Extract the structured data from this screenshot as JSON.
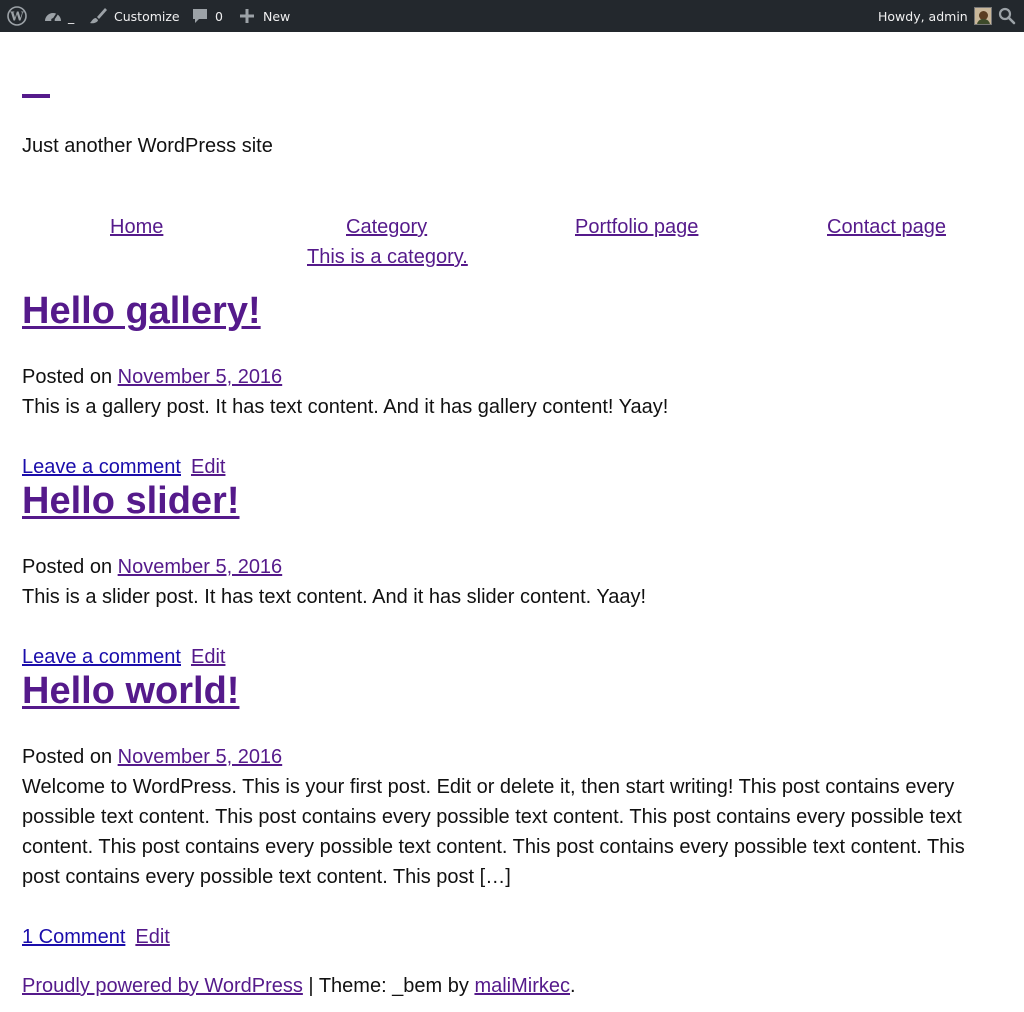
{
  "admin_bar": {
    "wp_logo_icon": "wordpress-logo-icon",
    "dashboard_icon": "dashboard-gauge-icon",
    "site_name": "_",
    "customize_label": "Customize",
    "comments_count": "0",
    "new_label": "New",
    "howdy_label": "Howdy, admin",
    "search_icon": "search-icon",
    "colors": {
      "background": "#23282d",
      "text": "#eeeeee",
      "muted": "#9ca2a7"
    }
  },
  "site": {
    "tagline": "Just another WordPress site",
    "accent": "#551a8b"
  },
  "nav": {
    "items": [
      {
        "label": "Home"
      },
      {
        "label": "Category"
      },
      {
        "label": "Portfolio page"
      },
      {
        "label": "Contact page"
      },
      {
        "label": "This is a category."
      }
    ]
  },
  "posts": [
    {
      "title": "Hello gallery!",
      "posted_on_label": "Posted on",
      "date": "November 5, 2016",
      "excerpt": "This is a gallery post. It has text content. And it has gallery content! Yaay!",
      "comment_link": "Leave a comment",
      "edit_link": "Edit"
    },
    {
      "title": "Hello slider!",
      "posted_on_label": "Posted on",
      "date": "November 5, 2016",
      "excerpt": "This is a slider post. It has text content. And it has slider content. Yaay!",
      "comment_link": "Leave a comment",
      "edit_link": "Edit"
    },
    {
      "title": "Hello world!",
      "posted_on_label": "Posted on",
      "date": "November 5, 2016",
      "excerpt": "Welcome to WordPress. This is your first post. Edit or delete it, then start writing! This post contains every possible text content. This post contains every possible text content. This post contains every possible text content. This post contains every possible text content. This post contains every possible text content. This post contains every possible text content. This post […]",
      "comment_link": "1 Comment",
      "edit_link": "Edit"
    }
  ],
  "footer": {
    "powered_by": "Proudly powered by WordPress",
    "separator": " | Theme: _bem by ",
    "author": "maliMirkec",
    "end": "."
  }
}
